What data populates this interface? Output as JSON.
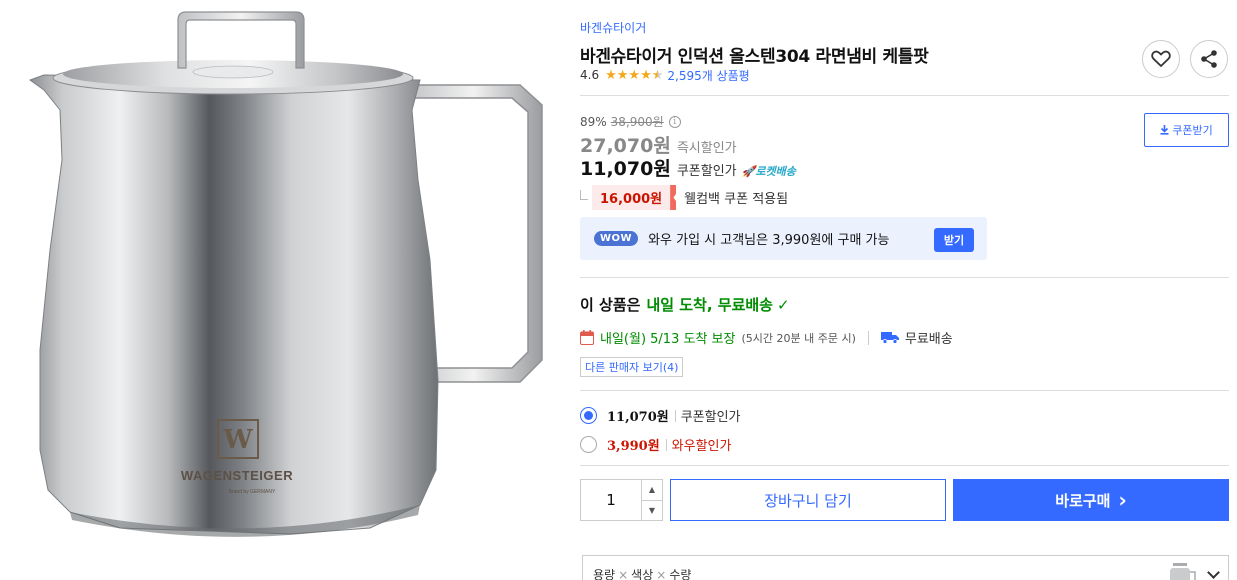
{
  "product": {
    "brand": "바겐슈타이거",
    "title": "바겐슈타이거 인덕션 올스텐304 라면냄비 케틀팟",
    "rating": "4.6",
    "stars": 4.5,
    "review_count": "2,595개 상품평",
    "image_alt_icon": "kettle-product-image",
    "logo_text": "WAGENSTEIGER",
    "logo_sub": "Brand by GERMANY"
  },
  "actions": {
    "heart_icon": "heart-icon",
    "share_icon": "share-icon",
    "coupon_button": "쿠폰받기"
  },
  "pricing": {
    "discount_rate": "89%",
    "original_price": "38,900원",
    "info_glyph": "i",
    "instant_price": "27,070원",
    "instant_label": "즉시할인가",
    "coupon_price": "11,070원",
    "coupon_label": "쿠폰할인가",
    "rocket_label": "로켓배송",
    "welcome_amount": "16,000원",
    "welcome_text": "웰컴백 쿠폰 적용됨"
  },
  "wow": {
    "badge": "WOW",
    "text": "와우 가입 시 고객님은 3,990원에 구매 가능",
    "button": "받기"
  },
  "delivery": {
    "headline_prefix": "이 상품은",
    "headline_green": "내일 도착, 무료배송",
    "check": "✓",
    "date": "내일(월) 5/13 도착 보장",
    "note": "(5시간 20분 내 주문 시)",
    "free_shipping": "무료배송",
    "other_sellers": "다른 판매자 보기(4)"
  },
  "options": [
    {
      "price": "11,070원",
      "label": "쿠폰할인가",
      "selected": true
    },
    {
      "price": "3,990원",
      "label": "와우할인가",
      "selected": false
    }
  ],
  "purchase": {
    "quantity": "1",
    "cart_button": "장바구니 담기",
    "buy_button": "바로구매",
    "buy_chevron": "›"
  },
  "option_select": {
    "part1": "용량",
    "part2": "색상",
    "part3": "수량",
    "sep": "×"
  },
  "colors": {
    "accent": "#346aff",
    "green": "#008c00",
    "red": "#cb1400",
    "star": "#f3a81a"
  }
}
